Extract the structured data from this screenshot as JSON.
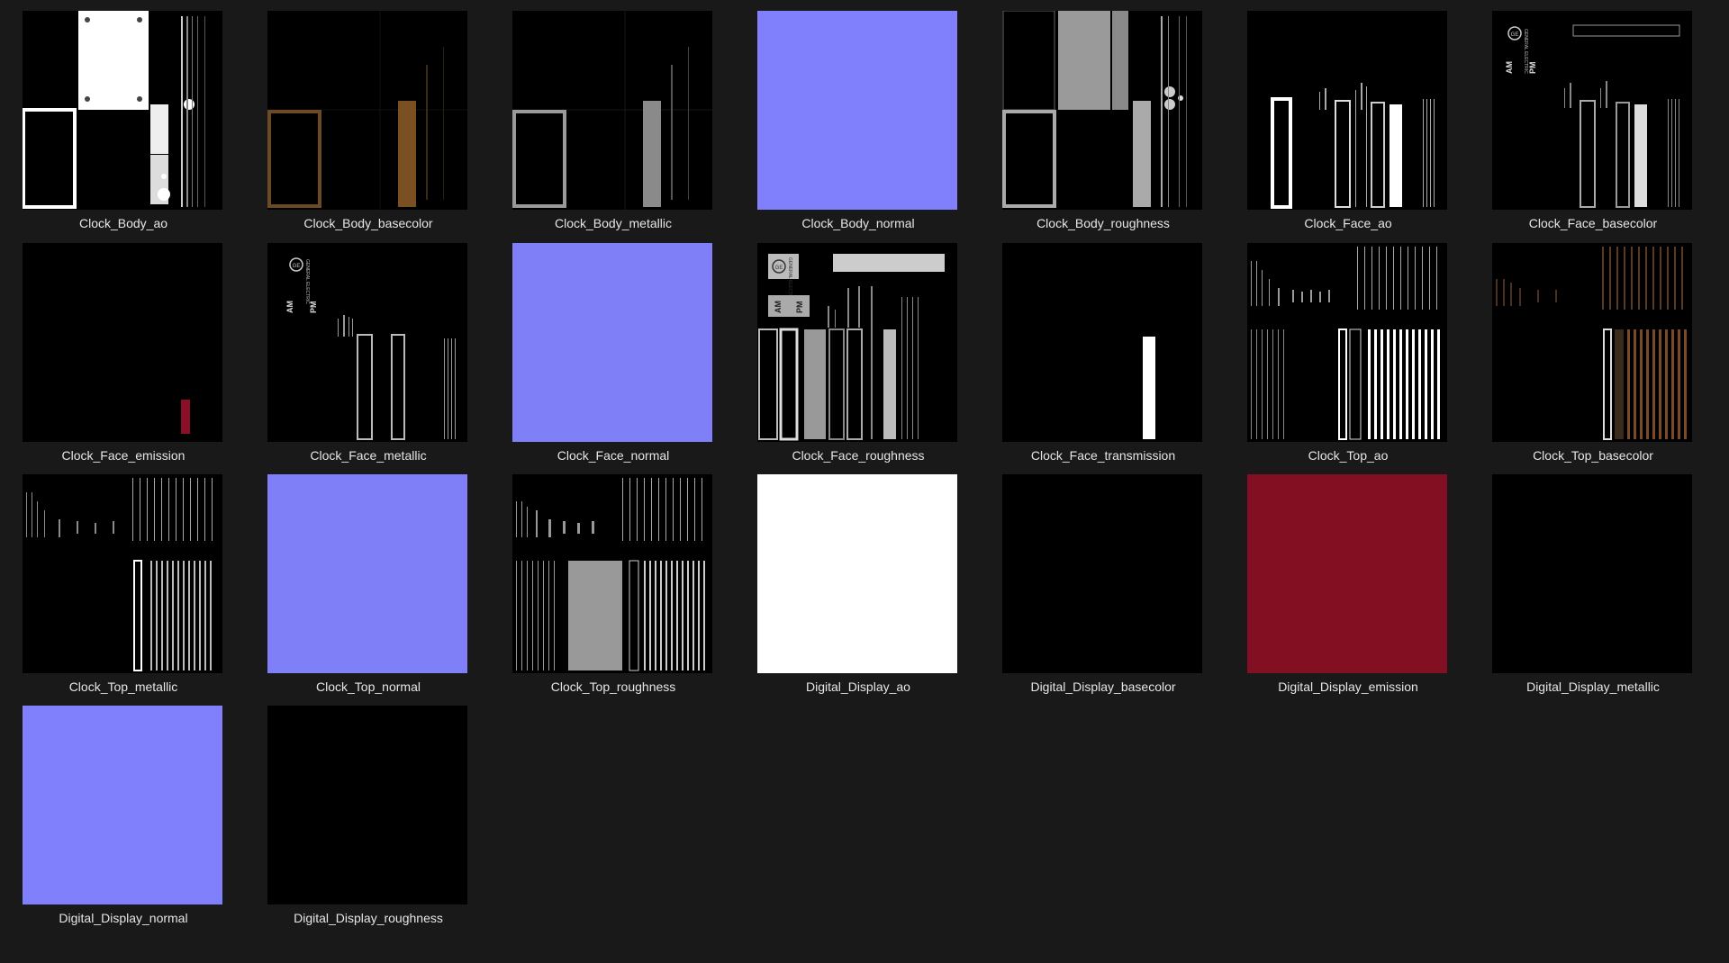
{
  "explorer": {
    "files": [
      {
        "name": "Clock_Body_ao"
      },
      {
        "name": "Clock_Body_basecolor"
      },
      {
        "name": "Clock_Body_metallic"
      },
      {
        "name": "Clock_Body_normal"
      },
      {
        "name": "Clock_Body_roughness"
      },
      {
        "name": "Clock_Face_ao"
      },
      {
        "name": "Clock_Face_basecolor",
        "thumb_text": [
          "GENERAL ELECTRIC",
          "AM",
          "PM"
        ]
      },
      {
        "name": "Clock_Face_emission"
      },
      {
        "name": "Clock_Face_metallic",
        "thumb_text": [
          "GENERAL ELECTRIC",
          "AM",
          "PM"
        ]
      },
      {
        "name": "Clock_Face_normal"
      },
      {
        "name": "Clock_Face_roughness",
        "thumb_text": [
          "GENERAL ELECTRIC",
          "AM",
          "PM"
        ]
      },
      {
        "name": "Clock_Face_transmission"
      },
      {
        "name": "Clock_Top_ao"
      },
      {
        "name": "Clock_Top_basecolor"
      },
      {
        "name": "Clock_Top_metallic"
      },
      {
        "name": "Clock_Top_normal"
      },
      {
        "name": "Clock_Top_roughness"
      },
      {
        "name": "Digital_Display_ao"
      },
      {
        "name": "Digital_Display_basecolor"
      },
      {
        "name": "Digital_Display_emission"
      },
      {
        "name": "Digital_Display_metallic"
      },
      {
        "name": "Digital_Display_normal"
      },
      {
        "name": "Digital_Display_roughness"
      }
    ]
  },
  "colors": {
    "background": "#191919",
    "normal_map": "#8080fc",
    "emission_red": "#830f22",
    "label": "#e6e6e6"
  }
}
